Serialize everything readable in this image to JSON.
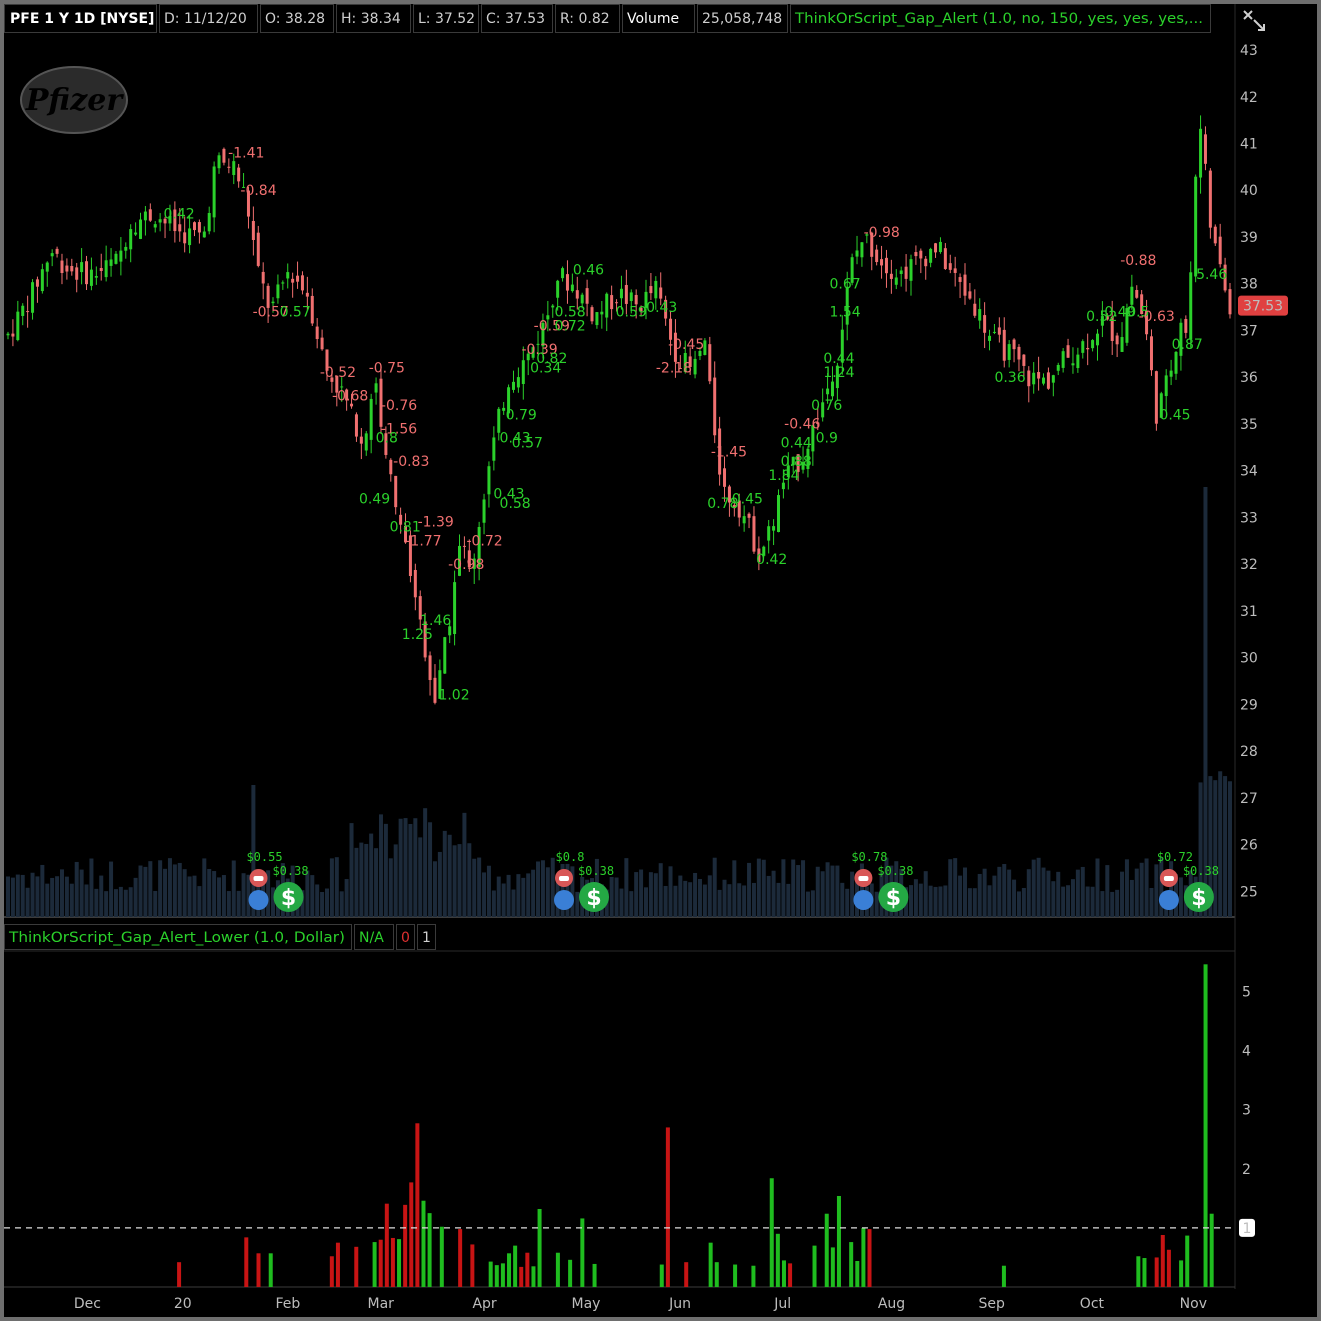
{
  "header": {
    "symbol": "PFE 1 Y 1D [NYSE]",
    "date": "D: 11/12/20",
    "open": "O: 38.28",
    "high": "H: 38.34",
    "low": "L: 37.52",
    "close": "C: 37.53",
    "range": "R: 0.82",
    "volume_label": "Volume",
    "volume_value": "25,058,748",
    "study": "ThinkOrScript_Gap_Alert (1.0, no, 150, yes, yes, yes,..."
  },
  "lower_header": {
    "study": "ThinkOrScript_Gap_Alert_Lower (1.0, Dollar)",
    "na": "N/A",
    "zero": "0",
    "one": "1"
  },
  "logo_text": "Pfizer",
  "price_tag": "37.53",
  "colors": {
    "up": "#2bd12b",
    "down": "#f07070",
    "volume": "#1c2a3a",
    "bar_up": "#1fbd1f",
    "bar_down": "#c81414",
    "dividend": "#24a844",
    "earnings_pending": "#d95757",
    "earnings_info": "#3a7fd6"
  },
  "chart_data": [
    {
      "type": "candlestick",
      "series": [
        {
          "name": "PFE"
        }
      ],
      "x_ticks": [
        "Dec",
        "20",
        "Feb",
        "Mar",
        "Apr",
        "May",
        "Jun",
        "Jul",
        "Aug",
        "Sep",
        "Oct",
        "Nov"
      ],
      "y_ticks": [
        "25",
        "26",
        "27",
        "28",
        "29",
        "30",
        "31",
        "32",
        "33",
        "34",
        "35",
        "36",
        "37",
        "38",
        "39",
        "40",
        "41",
        "42",
        "43"
      ],
      "ylim": [
        24.6,
        43.3
      ],
      "grid": false,
      "price_path": [
        {
          "t": 0,
          "p": 36.9
        },
        {
          "t": 0.02,
          "p": 37.8
        },
        {
          "t": 0.035,
          "p": 38.7
        },
        {
          "t": 0.05,
          "p": 38.3
        },
        {
          "t": 0.07,
          "p": 38.2
        },
        {
          "t": 0.09,
          "p": 38.5
        },
        {
          "t": 0.1,
          "p": 39.3
        },
        {
          "t": 0.12,
          "p": 39.5
        },
        {
          "t": 0.14,
          "p": 39.1
        },
        {
          "t": 0.16,
          "p": 39.0
        },
        {
          "t": 0.17,
          "p": 40.6
        },
        {
          "t": 0.185,
          "p": 40.5
        },
        {
          "t": 0.195,
          "p": 39.8
        },
        {
          "t": 0.205,
          "p": 38.2
        },
        {
          "t": 0.215,
          "p": 37.4
        },
        {
          "t": 0.23,
          "p": 38.3
        },
        {
          "t": 0.245,
          "p": 37.8
        },
        {
          "t": 0.26,
          "p": 36.2
        },
        {
          "t": 0.275,
          "p": 35.6
        },
        {
          "t": 0.29,
          "p": 34.5
        },
        {
          "t": 0.3,
          "p": 36.0
        },
        {
          "t": 0.31,
          "p": 34.2
        },
        {
          "t": 0.32,
          "p": 33.0
        },
        {
          "t": 0.33,
          "p": 31.8
        },
        {
          "t": 0.34,
          "p": 30.4
        },
        {
          "t": 0.35,
          "p": 29.0
        },
        {
          "t": 0.36,
          "p": 30.6
        },
        {
          "t": 0.37,
          "p": 32.4
        },
        {
          "t": 0.38,
          "p": 32.0
        },
        {
          "t": 0.39,
          "p": 33.6
        },
        {
          "t": 0.4,
          "p": 34.9
        },
        {
          "t": 0.41,
          "p": 36.0
        },
        {
          "t": 0.425,
          "p": 36.4
        },
        {
          "t": 0.44,
          "p": 37.2
        },
        {
          "t": 0.45,
          "p": 38.2
        },
        {
          "t": 0.465,
          "p": 37.9
        },
        {
          "t": 0.48,
          "p": 37.3
        },
        {
          "t": 0.5,
          "p": 37.8
        },
        {
          "t": 0.515,
          "p": 37.5
        },
        {
          "t": 0.53,
          "p": 37.9
        },
        {
          "t": 0.545,
          "p": 36.6
        },
        {
          "t": 0.56,
          "p": 36.1
        },
        {
          "t": 0.57,
          "p": 36.8
        },
        {
          "t": 0.575,
          "p": 35.5
        },
        {
          "t": 0.585,
          "p": 33.6
        },
        {
          "t": 0.6,
          "p": 33.2
        },
        {
          "t": 0.615,
          "p": 32.2
        },
        {
          "t": 0.625,
          "p": 32.8
        },
        {
          "t": 0.635,
          "p": 33.8
        },
        {
          "t": 0.65,
          "p": 34.3
        },
        {
          "t": 0.665,
          "p": 35.3
        },
        {
          "t": 0.68,
          "p": 36.6
        },
        {
          "t": 0.69,
          "p": 38.4
        },
        {
          "t": 0.7,
          "p": 39.0
        },
        {
          "t": 0.715,
          "p": 38.5
        },
        {
          "t": 0.73,
          "p": 38.2
        },
        {
          "t": 0.745,
          "p": 38.5
        },
        {
          "t": 0.76,
          "p": 38.8
        },
        {
          "t": 0.775,
          "p": 38.1
        },
        {
          "t": 0.79,
          "p": 37.6
        },
        {
          "t": 0.805,
          "p": 36.8
        },
        {
          "t": 0.82,
          "p": 36.5
        },
        {
          "t": 0.835,
          "p": 36.0
        },
        {
          "t": 0.85,
          "p": 35.9
        },
        {
          "t": 0.865,
          "p": 36.4
        },
        {
          "t": 0.88,
          "p": 36.7
        },
        {
          "t": 0.895,
          "p": 37.2
        },
        {
          "t": 0.91,
          "p": 36.8
        },
        {
          "t": 0.92,
          "p": 38.0
        },
        {
          "t": 0.93,
          "p": 37.2
        },
        {
          "t": 0.94,
          "p": 35.2
        },
        {
          "t": 0.95,
          "p": 36.0
        },
        {
          "t": 0.96,
          "p": 37.3
        },
        {
          "t": 0.965,
          "p": 36.9
        },
        {
          "t": 0.975,
          "p": 41.6
        },
        {
          "t": 0.985,
          "p": 39.0
        },
        {
          "t": 1.0,
          "p": 37.53
        }
      ],
      "gap_labels": [
        {
          "t": 0.195,
          "p": 40.7,
          "text": "-1.41",
          "dir": "down"
        },
        {
          "t": 0.14,
          "p": 39.4,
          "text": "0.42",
          "dir": "up"
        },
        {
          "t": 0.205,
          "p": 39.9,
          "text": "-0.84",
          "dir": "down"
        },
        {
          "t": 0.215,
          "p": 37.3,
          "text": "-0.57",
          "dir": "down"
        },
        {
          "t": 0.235,
          "p": 37.3,
          "text": "0.57",
          "dir": "up"
        },
        {
          "t": 0.27,
          "p": 36.0,
          "text": "-0.52",
          "dir": "down"
        },
        {
          "t": 0.31,
          "p": 36.1,
          "text": "-0.75",
          "dir": "down"
        },
        {
          "t": 0.28,
          "p": 35.5,
          "text": "-0.68",
          "dir": "down"
        },
        {
          "t": 0.32,
          "p": 35.3,
          "text": "-0.76",
          "dir": "down"
        },
        {
          "t": 0.32,
          "p": 34.8,
          "text": "-1.56",
          "dir": "down"
        },
        {
          "t": 0.31,
          "p": 34.6,
          "text": "0.8",
          "dir": "up"
        },
        {
          "t": 0.33,
          "p": 34.1,
          "text": "-0.83",
          "dir": "down"
        },
        {
          "t": 0.3,
          "p": 33.3,
          "text": "0.49",
          "dir": "up"
        },
        {
          "t": 0.35,
          "p": 32.8,
          "text": "-1.39",
          "dir": "down"
        },
        {
          "t": 0.325,
          "p": 32.7,
          "text": "0.81",
          "dir": "up"
        },
        {
          "t": 0.34,
          "p": 32.4,
          "text": "-1.77",
          "dir": "down"
        },
        {
          "t": 0.39,
          "p": 32.4,
          "text": "-0.72",
          "dir": "down"
        },
        {
          "t": 0.375,
          "p": 31.9,
          "text": "-0.98",
          "dir": "down"
        },
        {
          "t": 0.35,
          "p": 30.7,
          "text": "1.46",
          "dir": "up"
        },
        {
          "t": 0.335,
          "p": 30.4,
          "text": "1.25",
          "dir": "up"
        },
        {
          "t": 0.365,
          "p": 29.1,
          "text": "1.02",
          "dir": "up"
        },
        {
          "t": 0.41,
          "p": 33.4,
          "text": "0.43",
          "dir": "up"
        },
        {
          "t": 0.415,
          "p": 33.2,
          "text": "0.58",
          "dir": "up"
        },
        {
          "t": 0.42,
          "p": 35.1,
          "text": "0.79",
          "dir": "up"
        },
        {
          "t": 0.415,
          "p": 34.6,
          "text": "0.43",
          "dir": "up"
        },
        {
          "t": 0.425,
          "p": 34.5,
          "text": "0.57",
          "dir": "up"
        },
        {
          "t": 0.44,
          "p": 36.1,
          "text": "0.34",
          "dir": "up"
        },
        {
          "t": 0.435,
          "p": 36.5,
          "text": "-0.39",
          "dir": "down"
        },
        {
          "t": 0.445,
          "p": 36.3,
          "text": "0.82",
          "dir": "up"
        },
        {
          "t": 0.445,
          "p": 37.0,
          "text": "-0.59",
          "dir": "down"
        },
        {
          "t": 0.46,
          "p": 37.0,
          "text": "0.72",
          "dir": "up"
        },
        {
          "t": 0.46,
          "p": 37.3,
          "text": "0.58",
          "dir": "up"
        },
        {
          "t": 0.475,
          "p": 38.2,
          "text": "0.46",
          "dir": "up"
        },
        {
          "t": 0.51,
          "p": 37.3,
          "text": "0.59",
          "dir": "up"
        },
        {
          "t": 0.535,
          "p": 37.4,
          "text": "0.43",
          "dir": "up"
        },
        {
          "t": 0.555,
          "p": 36.6,
          "text": "-0.45",
          "dir": "down"
        },
        {
          "t": 0.545,
          "p": 36.1,
          "text": "-2.18",
          "dir": "down"
        },
        {
          "t": 0.59,
          "p": 34.3,
          "text": "-1.45",
          "dir": "down"
        },
        {
          "t": 0.585,
          "p": 33.2,
          "text": "0.78",
          "dir": "up"
        },
        {
          "t": 0.605,
          "p": 33.3,
          "text": "0.45",
          "dir": "up"
        },
        {
          "t": 0.625,
          "p": 32.0,
          "text": "0.42",
          "dir": "up"
        },
        {
          "t": 0.65,
          "p": 34.9,
          "text": "-0.46",
          "dir": "down"
        },
        {
          "t": 0.645,
          "p": 34.5,
          "text": "0.44",
          "dir": "up"
        },
        {
          "t": 0.67,
          "p": 34.6,
          "text": "0.9",
          "dir": "up"
        },
        {
          "t": 0.645,
          "p": 34.1,
          "text": "0.88",
          "dir": "up"
        },
        {
          "t": 0.635,
          "p": 33.8,
          "text": "1.84",
          "dir": "up"
        },
        {
          "t": 0.67,
          "p": 35.3,
          "text": "0.76",
          "dir": "up"
        },
        {
          "t": 0.68,
          "p": 36.0,
          "text": "1.24",
          "dir": "up"
        },
        {
          "t": 0.68,
          "p": 36.3,
          "text": "0.44",
          "dir": "up"
        },
        {
          "t": 0.685,
          "p": 37.3,
          "text": "1.54",
          "dir": "up"
        },
        {
          "t": 0.685,
          "p": 37.9,
          "text": "0.67",
          "dir": "up"
        },
        {
          "t": 0.715,
          "p": 39.0,
          "text": "-0.98",
          "dir": "down"
        },
        {
          "t": 0.82,
          "p": 35.9,
          "text": "0.36",
          "dir": "up"
        },
        {
          "t": 0.895,
          "p": 37.2,
          "text": "0.52",
          "dir": "up"
        },
        {
          "t": 0.925,
          "p": 38.4,
          "text": "-0.88",
          "dir": "down"
        },
        {
          "t": 0.91,
          "p": 37.3,
          "text": "0.49",
          "dir": "up"
        },
        {
          "t": 0.925,
          "p": 37.3,
          "text": "0.5",
          "dir": "up"
        },
        {
          "t": 0.94,
          "p": 37.2,
          "text": "-0.63",
          "dir": "down"
        },
        {
          "t": 0.965,
          "p": 36.6,
          "text": "0.87",
          "dir": "up"
        },
        {
          "t": 0.955,
          "p": 35.1,
          "text": "0.45",
          "dir": "up"
        },
        {
          "t": 0.985,
          "p": 38.1,
          "text": "5.46",
          "dir": "up"
        }
      ],
      "events": [
        {
          "t": 0.205,
          "kind": "earnings",
          "amount": "$0.55",
          "amount_color": "up"
        },
        {
          "t": 0.205,
          "kind": "dividend",
          "amount": "$0.38"
        },
        {
          "t": 0.455,
          "kind": "pending",
          "amount": "$0.8",
          "amount_color": "up"
        },
        {
          "t": 0.455,
          "kind": "dividend",
          "amount": "$0.38"
        },
        {
          "t": 0.7,
          "kind": "earnings",
          "amount": "$0.78",
          "amount_color": "up"
        },
        {
          "t": 0.7,
          "kind": "dividend",
          "amount": "$0.38"
        },
        {
          "t": 0.95,
          "kind": "pending",
          "amount": "$0.72",
          "amount_color": "up"
        },
        {
          "t": 0.95,
          "kind": "dividend",
          "amount": "$0.38"
        }
      ]
    },
    {
      "type": "bar",
      "series": [
        {
          "name": "ThinkOrScript_Gap_Alert_Lower"
        }
      ],
      "y_ticks": [
        "1",
        "2",
        "3",
        "4",
        "5"
      ],
      "ylim": [
        0,
        5.55
      ],
      "threshold": 1,
      "bars": [
        {
          "t": 0.14,
          "v": 0.42,
          "dir": "down"
        },
        {
          "t": 0.195,
          "v": 0.84,
          "dir": "down"
        },
        {
          "t": 0.205,
          "v": 0.57,
          "dir": "down"
        },
        {
          "t": 0.215,
          "v": 0.57,
          "dir": "up"
        },
        {
          "t": 0.265,
          "v": 0.52,
          "dir": "down"
        },
        {
          "t": 0.27,
          "v": 0.75,
          "dir": "down"
        },
        {
          "t": 0.285,
          "v": 0.68,
          "dir": "down"
        },
        {
          "t": 0.3,
          "v": 0.76,
          "dir": "up"
        },
        {
          "t": 0.305,
          "v": 0.8,
          "dir": "down"
        },
        {
          "t": 0.31,
          "v": 1.41,
          "dir": "down"
        },
        {
          "t": 0.315,
          "v": 0.83,
          "dir": "down"
        },
        {
          "t": 0.32,
          "v": 0.81,
          "dir": "up"
        },
        {
          "t": 0.325,
          "v": 1.39,
          "dir": "down"
        },
        {
          "t": 0.33,
          "v": 1.77,
          "dir": "down"
        },
        {
          "t": 0.335,
          "v": 2.77,
          "dir": "down"
        },
        {
          "t": 0.34,
          "v": 1.46,
          "dir": "up"
        },
        {
          "t": 0.345,
          "v": 1.25,
          "dir": "up"
        },
        {
          "t": 0.355,
          "v": 1.02,
          "dir": "up"
        },
        {
          "t": 0.37,
          "v": 0.98,
          "dir": "down"
        },
        {
          "t": 0.38,
          "v": 0.72,
          "dir": "down"
        },
        {
          "t": 0.395,
          "v": 0.43,
          "dir": "up"
        },
        {
          "t": 0.4,
          "v": 0.37,
          "dir": "up"
        },
        {
          "t": 0.405,
          "v": 0.4,
          "dir": "up"
        },
        {
          "t": 0.41,
          "v": 0.57,
          "dir": "up"
        },
        {
          "t": 0.415,
          "v": 0.7,
          "dir": "up"
        },
        {
          "t": 0.42,
          "v": 0.34,
          "dir": "down"
        },
        {
          "t": 0.425,
          "v": 0.58,
          "dir": "down"
        },
        {
          "t": 0.43,
          "v": 0.35,
          "dir": "up"
        },
        {
          "t": 0.435,
          "v": 1.32,
          "dir": "up"
        },
        {
          "t": 0.45,
          "v": 0.58,
          "dir": "up"
        },
        {
          "t": 0.46,
          "v": 0.46,
          "dir": "up"
        },
        {
          "t": 0.47,
          "v": 1.16,
          "dir": "up"
        },
        {
          "t": 0.48,
          "v": 0.39,
          "dir": "up"
        },
        {
          "t": 0.535,
          "v": 0.38,
          "dir": "up"
        },
        {
          "t": 0.54,
          "v": 2.7,
          "dir": "down"
        },
        {
          "t": 0.555,
          "v": 0.42,
          "dir": "down"
        },
        {
          "t": 0.575,
          "v": 0.75,
          "dir": "up"
        },
        {
          "t": 0.58,
          "v": 0.42,
          "dir": "up"
        },
        {
          "t": 0.595,
          "v": 0.38,
          "dir": "up"
        },
        {
          "t": 0.61,
          "v": 0.36,
          "dir": "up"
        },
        {
          "t": 0.625,
          "v": 1.84,
          "dir": "up"
        },
        {
          "t": 0.63,
          "v": 0.9,
          "dir": "up"
        },
        {
          "t": 0.635,
          "v": 0.45,
          "dir": "up"
        },
        {
          "t": 0.64,
          "v": 0.4,
          "dir": "down"
        },
        {
          "t": 0.66,
          "v": 0.7,
          "dir": "up"
        },
        {
          "t": 0.67,
          "v": 1.24,
          "dir": "up"
        },
        {
          "t": 0.675,
          "v": 0.67,
          "dir": "up"
        },
        {
          "t": 0.68,
          "v": 1.54,
          "dir": "up"
        },
        {
          "t": 0.69,
          "v": 0.76,
          "dir": "up"
        },
        {
          "t": 0.695,
          "v": 0.44,
          "dir": "up"
        },
        {
          "t": 0.7,
          "v": 1.0,
          "dir": "up"
        },
        {
          "t": 0.705,
          "v": 0.98,
          "dir": "down"
        },
        {
          "t": 0.815,
          "v": 0.36,
          "dir": "up"
        },
        {
          "t": 0.925,
          "v": 0.52,
          "dir": "up"
        },
        {
          "t": 0.93,
          "v": 0.49,
          "dir": "up"
        },
        {
          "t": 0.94,
          "v": 0.5,
          "dir": "down"
        },
        {
          "t": 0.945,
          "v": 0.88,
          "dir": "down"
        },
        {
          "t": 0.95,
          "v": 0.63,
          "dir": "down"
        },
        {
          "t": 0.96,
          "v": 0.45,
          "dir": "up"
        },
        {
          "t": 0.965,
          "v": 0.87,
          "dir": "up"
        },
        {
          "t": 0.98,
          "v": 5.46,
          "dir": "up"
        },
        {
          "t": 0.985,
          "v": 1.24,
          "dir": "up"
        }
      ]
    }
  ]
}
